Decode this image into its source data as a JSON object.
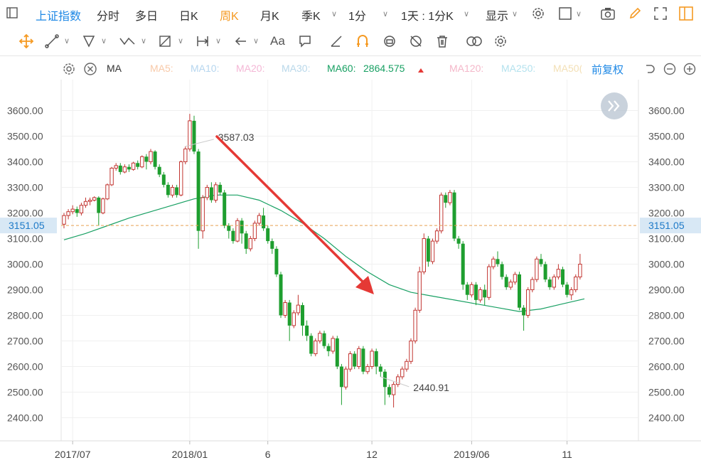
{
  "toolbar": {
    "market": "上证指数",
    "periods": [
      "分时",
      "多日",
      "日K",
      "周K",
      "月K",
      "季K"
    ],
    "active_period": "周K",
    "minute_select": "1分",
    "range_select": "1天 : 1分K",
    "display": "显示"
  },
  "indicators": {
    "name": "MA",
    "items": [
      {
        "label": "MA5:",
        "color": "#f8c9a8"
      },
      {
        "label": "MA10:",
        "color": "#b6d6ef"
      },
      {
        "label": "MA20:",
        "color": "#f4b7d6"
      },
      {
        "label": "MA30:",
        "color": "#b9d8ea"
      },
      {
        "label": "MA60:",
        "value": "2864.575",
        "color": "#18a063"
      },
      {
        "label": "MA120:",
        "color": "#f4b7c9"
      },
      {
        "label": "MA250:",
        "color": "#b4e2ee"
      },
      {
        "label": "MA50(",
        "color": "#f3e0b6"
      }
    ],
    "adjust": "前复权"
  },
  "colors": {
    "up": "#c23531",
    "down": "#1e9e2f",
    "ma60": "#18a063",
    "accent": "#1e88e5",
    "active": "#f59a23",
    "price_line": "#e8a050"
  },
  "chart_data": {
    "type": "candlestick",
    "title": "",
    "ylim": [
      2360,
      3660
    ],
    "yticks": [
      "3600.00",
      "3500.00",
      "3400.00",
      "3300.00",
      "3200.00",
      "3100.00",
      "3000.00",
      "2900.00",
      "2800.00",
      "2700.00",
      "2600.00",
      "2500.00",
      "2400.00"
    ],
    "xtick_labels": [
      {
        "i": 2,
        "label": "2017/07"
      },
      {
        "i": 29,
        "label": "2018/01"
      },
      {
        "i": 47,
        "label": "6"
      },
      {
        "i": 71,
        "label": "12"
      },
      {
        "i": 94,
        "label": "2019/06"
      },
      {
        "i": 116,
        "label": "11"
      }
    ],
    "current_price": "3151.05",
    "current_value": 3151.05,
    "high_label": {
      "i": 28,
      "value": "3587.03"
    },
    "low_label": {
      "i": 73,
      "value": "2440.91"
    },
    "candles": [
      [
        3156,
        3190,
        3140,
        3200
      ],
      [
        3190,
        3205,
        3175,
        3215
      ],
      [
        3205,
        3215,
        3195,
        3230
      ],
      [
        3215,
        3200,
        3185,
        3225
      ],
      [
        3200,
        3230,
        3190,
        3240
      ],
      [
        3230,
        3245,
        3220,
        3260
      ],
      [
        3245,
        3250,
        3230,
        3260
      ],
      [
        3250,
        3260,
        3245,
        3265
      ],
      [
        3260,
        3200,
        3150,
        3265
      ],
      [
        3200,
        3255,
        3195,
        3260
      ],
      [
        3255,
        3310,
        3250,
        3315
      ],
      [
        3310,
        3375,
        3305,
        3380
      ],
      [
        3375,
        3385,
        3365,
        3395
      ],
      [
        3385,
        3360,
        3350,
        3395
      ],
      [
        3360,
        3380,
        3355,
        3390
      ],
      [
        3380,
        3370,
        3360,
        3390
      ],
      [
        3370,
        3395,
        3365,
        3400
      ],
      [
        3395,
        3380,
        3370,
        3405
      ],
      [
        3380,
        3420,
        3375,
        3425
      ],
      [
        3420,
        3400,
        3370,
        3430
      ],
      [
        3400,
        3440,
        3390,
        3450
      ],
      [
        3440,
        3380,
        3370,
        3445
      ],
      [
        3380,
        3350,
        3340,
        3390
      ],
      [
        3350,
        3310,
        3300,
        3360
      ],
      [
        3310,
        3270,
        3260,
        3320
      ],
      [
        3270,
        3300,
        3260,
        3310
      ],
      [
        3300,
        3270,
        3260,
        3310
      ],
      [
        3270,
        3400,
        3265,
        3405
      ],
      [
        3400,
        3450,
        3390,
        3460
      ],
      [
        3450,
        3560,
        3440,
        3587
      ],
      [
        3560,
        3440,
        3430,
        3580
      ],
      [
        3440,
        3130,
        3060,
        3450
      ],
      [
        3130,
        3260,
        3100,
        3270
      ],
      [
        3260,
        3300,
        3250,
        3310
      ],
      [
        3300,
        3250,
        3240,
        3320
      ],
      [
        3250,
        3310,
        3240,
        3320
      ],
      [
        3310,
        3280,
        3270,
        3320
      ],
      [
        3280,
        3150,
        3140,
        3290
      ],
      [
        3150,
        3130,
        3100,
        3160
      ],
      [
        3130,
        3090,
        3080,
        3140
      ],
      [
        3090,
        3170,
        3085,
        3180
      ],
      [
        3170,
        3120,
        3080,
        3180
      ],
      [
        3120,
        3060,
        3040,
        3130
      ],
      [
        3060,
        3100,
        3050,
        3110
      ],
      [
        3100,
        3160,
        3090,
        3170
      ],
      [
        3160,
        3190,
        3150,
        3200
      ],
      [
        3190,
        3140,
        3130,
        3220
      ],
      [
        3140,
        3090,
        3080,
        3150
      ],
      [
        3090,
        3060,
        3040,
        3100
      ],
      [
        3060,
        2960,
        2950,
        3070
      ],
      [
        2960,
        2800,
        2790,
        2970
      ],
      [
        2800,
        2850,
        2790,
        2860
      ],
      [
        2850,
        2760,
        2700,
        2860
      ],
      [
        2760,
        2810,
        2750,
        2820
      ],
      [
        2810,
        2840,
        2800,
        2880
      ],
      [
        2840,
        2760,
        2720,
        2850
      ],
      [
        2760,
        2720,
        2700,
        2780
      ],
      [
        2720,
        2650,
        2640,
        2730
      ],
      [
        2650,
        2700,
        2640,
        2710
      ],
      [
        2700,
        2730,
        2690,
        2740
      ],
      [
        2730,
        2680,
        2670,
        2740
      ],
      [
        2680,
        2660,
        2640,
        2690
      ],
      [
        2660,
        2710,
        2650,
        2720
      ],
      [
        2710,
        2600,
        2590,
        2720
      ],
      [
        2600,
        2520,
        2450,
        2610
      ],
      [
        2520,
        2590,
        2510,
        2600
      ],
      [
        2590,
        2650,
        2580,
        2660
      ],
      [
        2650,
        2600,
        2590,
        2660
      ],
      [
        2600,
        2670,
        2590,
        2680
      ],
      [
        2670,
        2580,
        2570,
        2680
      ],
      [
        2580,
        2600,
        2570,
        2610
      ],
      [
        2600,
        2660,
        2590,
        2670
      ],
      [
        2660,
        2600,
        2570,
        2670
      ],
      [
        2600,
        2580,
        2560,
        2610
      ],
      [
        2580,
        2520,
        2450,
        2590
      ],
      [
        2520,
        2490,
        2480,
        2530
      ],
      [
        2490,
        2530,
        2440,
        2540
      ],
      [
        2530,
        2560,
        2520,
        2570
      ],
      [
        2560,
        2590,
        2550,
        2600
      ],
      [
        2590,
        2620,
        2580,
        2630
      ],
      [
        2620,
        2700,
        2610,
        2710
      ],
      [
        2700,
        2820,
        2690,
        2830
      ],
      [
        2820,
        2970,
        2810,
        2990
      ],
      [
        2970,
        3100,
        2960,
        3120
      ],
      [
        3100,
        3010,
        2990,
        3110
      ],
      [
        3010,
        3090,
        3000,
        3100
      ],
      [
        3090,
        3130,
        3080,
        3140
      ],
      [
        3130,
        3270,
        3120,
        3280
      ],
      [
        3270,
        3240,
        3220,
        3280
      ],
      [
        3240,
        3280,
        3230,
        3290
      ],
      [
        3280,
        3100,
        3090,
        3290
      ],
      [
        3100,
        3080,
        3060,
        3110
      ],
      [
        3080,
        2920,
        2900,
        3090
      ],
      [
        2920,
        2880,
        2860,
        2930
      ],
      [
        2880,
        2920,
        2870,
        2930
      ],
      [
        2920,
        2860,
        2840,
        2930
      ],
      [
        2860,
        2900,
        2850,
        2910
      ],
      [
        2900,
        2870,
        2840,
        2920
      ],
      [
        2870,
        2990,
        2860,
        3000
      ],
      [
        2990,
        3020,
        2980,
        3030
      ],
      [
        3020,
        3000,
        2990,
        3050
      ],
      [
        3000,
        2950,
        2940,
        3010
      ],
      [
        2950,
        2910,
        2900,
        2960
      ],
      [
        2910,
        2930,
        2900,
        2940
      ],
      [
        2930,
        2960,
        2920,
        2970
      ],
      [
        2960,
        2830,
        2820,
        2970
      ],
      [
        2830,
        2800,
        2740,
        2840
      ],
      [
        2800,
        2900,
        2790,
        2910
      ],
      [
        2900,
        2940,
        2890,
        2950
      ],
      [
        2940,
        3020,
        2930,
        3030
      ],
      [
        3020,
        3000,
        2990,
        3040
      ],
      [
        3000,
        2940,
        2930,
        3010
      ],
      [
        2940,
        2910,
        2900,
        2950
      ],
      [
        2910,
        2950,
        2900,
        2960
      ],
      [
        2950,
        2980,
        2940,
        3000
      ],
      [
        2980,
        2920,
        2910,
        2990
      ],
      [
        2920,
        2880,
        2870,
        2930
      ],
      [
        2880,
        2900,
        2860,
        2910
      ],
      [
        2900,
        2950,
        2890,
        2960
      ],
      [
        2950,
        3000,
        2940,
        3040
      ]
    ],
    "ma60": [
      [
        0,
        3095
      ],
      [
        5,
        3120
      ],
      [
        10,
        3150
      ],
      [
        15,
        3180
      ],
      [
        20,
        3205
      ],
      [
        25,
        3230
      ],
      [
        30,
        3255
      ],
      [
        35,
        3270
      ],
      [
        40,
        3270
      ],
      [
        45,
        3250
      ],
      [
        50,
        3210
      ],
      [
        55,
        3160
      ],
      [
        60,
        3100
      ],
      [
        65,
        3030
      ],
      [
        70,
        2970
      ],
      [
        75,
        2920
      ],
      [
        80,
        2890
      ],
      [
        85,
        2875
      ],
      [
        90,
        2860
      ],
      [
        95,
        2845
      ],
      [
        100,
        2830
      ],
      [
        105,
        2815
      ],
      [
        110,
        2825
      ],
      [
        115,
        2845
      ],
      [
        120,
        2864.575
      ]
    ]
  }
}
